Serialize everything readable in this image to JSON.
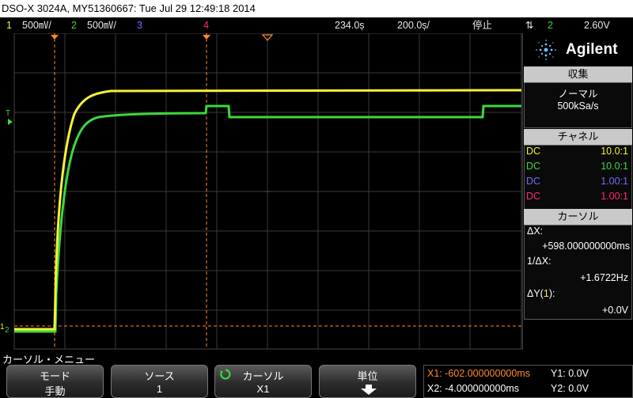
{
  "title": "DSO-X 3024A, MY51360667: Tue Jul 29 12:49:18 2014",
  "status": {
    "ch1_num": "1",
    "ch1_scale": "500㎷/",
    "ch2_num": "2",
    "ch2_scale": "500㎷/",
    "ch3_num": "3",
    "ch4_num": "4",
    "time_delay": "234.0ș",
    "time_scale": "200.0ș/",
    "run_state": "停止",
    "trigger_ch": "2",
    "trigger_level": "2.60V"
  },
  "screen": {
    "ch1_marker": "1",
    "ch2_marker": "2",
    "trigger_marker": "T"
  },
  "panel": {
    "brand": "Agilent",
    "acquire": {
      "header": "収集",
      "mode": "ノーマル",
      "rate": "500kSa/s"
    },
    "channels": {
      "header": "チャネル",
      "rows": [
        {
          "coupling": "DC",
          "probe": "10.0:1"
        },
        {
          "coupling": "DC",
          "probe": "10.0:1"
        },
        {
          "coupling": "DC",
          "probe": "1.00:1"
        },
        {
          "coupling": "DC",
          "probe": "1.00:1"
        }
      ]
    },
    "cursors": {
      "header": "カーソル",
      "dx_label": "ΔX:",
      "dx_value": "+598.000000000ms",
      "inv_dx_label": "1/ΔX:",
      "inv_dx_value": "+1.6722Hz",
      "dy_label_pre": "ΔY(",
      "dy_label_ch": "1",
      "dy_label_post": "):",
      "dy_value": "+0.0V"
    },
    "colors": {
      "ch1": "#f3f33a",
      "ch2": "#3cd83c",
      "ch3": "#6d6dff",
      "ch4": "#ff2d6d",
      "cursor": "#ff8a2a"
    }
  },
  "menu": {
    "title": "カーソル・メニュー",
    "softkeys": [
      {
        "label": "モード",
        "value": "手動"
      },
      {
        "label": "ソース",
        "value": "1"
      },
      {
        "label": "カーソル",
        "value": "X1"
      },
      {
        "label": "単位",
        "value": ""
      }
    ],
    "readout": {
      "x1": "X1: -602.000000000ms",
      "x2": "X2: -4.000000000ms",
      "y1": "Y1: 0.0V",
      "y2": "Y2: 0.0V"
    }
  }
}
